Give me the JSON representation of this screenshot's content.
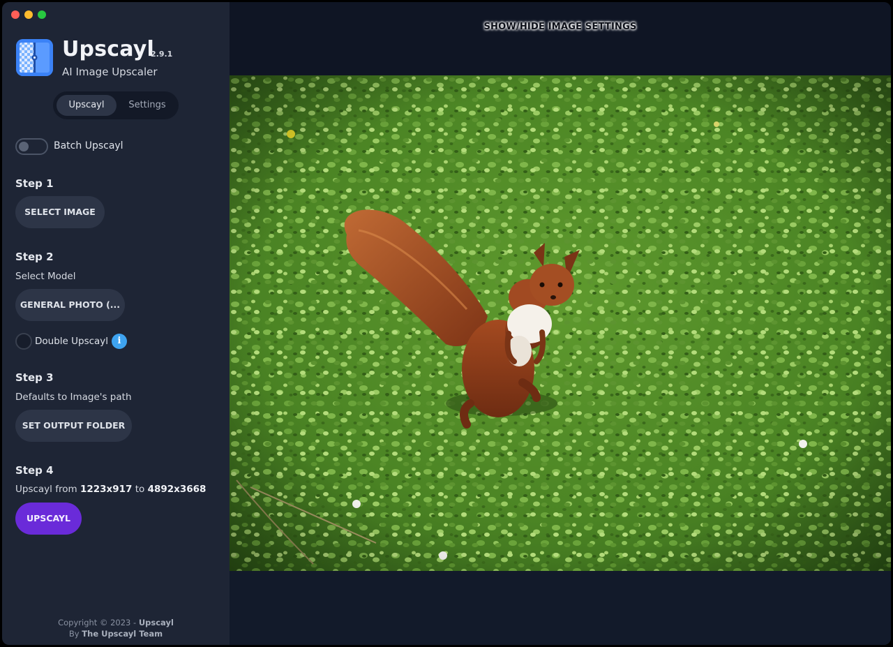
{
  "app": {
    "name": "Upscayl",
    "version": "2.9.1",
    "tagline": "AI Image Upscaler"
  },
  "tabs": [
    {
      "label": "Upscayl",
      "active": true
    },
    {
      "label": "Settings",
      "active": false
    }
  ],
  "batch": {
    "label": "Batch Upscayl",
    "enabled": false
  },
  "steps": {
    "step1": {
      "title": "Step 1",
      "button": "SELECT IMAGE"
    },
    "step2": {
      "title": "Step 2",
      "subtitle": "Select Model",
      "model_button": "GENERAL PHOTO (...",
      "double_upscayl": "Double Upscayl",
      "info_glyph": "i"
    },
    "step3": {
      "title": "Step 3",
      "subtitle": "Defaults to Image's path",
      "button": "SET OUTPUT FOLDER"
    },
    "step4": {
      "title": "Step 4",
      "prefix": "Upscayl from",
      "from_res": "1223x917",
      "connector": "to",
      "to_res": "4892x3668",
      "button": "UPSCAYL"
    }
  },
  "footer": {
    "copyright": "Copyright © 2023 -",
    "brand": "Upscayl",
    "by": "By",
    "team": "The Upscayl Team"
  },
  "main": {
    "toggle_label": "SHOW/HIDE IMAGE SETTINGS",
    "image_subject": "squirrel on grass"
  },
  "colors": {
    "sidebar_bg": "#1e2535",
    "main_bg": "#0f1524",
    "button_bg": "#2d3547",
    "primary": "#6a2bd9",
    "info": "#3ea3f0",
    "logo_blue": "#3b82f6"
  },
  "icons": [
    "upscayl-logo-icon",
    "info-icon"
  ]
}
